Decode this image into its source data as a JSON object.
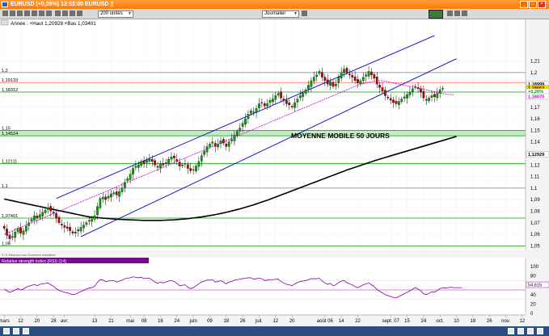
{
  "window": {
    "title": "EURUSD (+0,26%) 13:53:00 EURUSD || "
  },
  "toolbar": {
    "units": "200 unités",
    "period": "Journalier"
  },
  "header": {
    "info": "Année : +Haut 1,20928 +Bas 1,03401",
    "copyright": "© IT-Finance.com Données retardées"
  },
  "rsi": {
    "label": "Relative strength index (RSI) (14)",
    "value": "54,615"
  },
  "colors": {
    "ma50": "#c000c0",
    "ma200": "#000000",
    "channel": "#0000cc",
    "bull": "#00aa00",
    "bear": "#cc0000",
    "hline": "#7bc67b"
  },
  "chart_data": {
    "type": "candlestick",
    "instrument": "EURUSD",
    "period": "daily",
    "ylim": [
      1.045,
      1.225
    ],
    "yticks": [
      1.05,
      1.06,
      1.07,
      1.08,
      1.09,
      1.1,
      1.11,
      1.12,
      1.13,
      1.14,
      1.15,
      1.16,
      1.17,
      1.18,
      1.19,
      1.2,
      1.21
    ],
    "ytick_labels": [
      "1,05",
      "1,06",
      "1,07",
      "1,08",
      "1,09",
      "1,1",
      "1,11",
      "1,12",
      "1,13",
      "1,14",
      "1,15",
      "1,16",
      "1,17",
      "1,18",
      "1,19",
      "1,2",
      "1,21"
    ],
    "xticks": [
      {
        "label": "mars",
        "i": 0
      },
      {
        "label": "12",
        "i": 6
      },
      {
        "label": "20",
        "i": 12
      },
      {
        "label": "28",
        "i": 18
      },
      {
        "label": "avr.",
        "i": 22
      },
      {
        "label": "13",
        "i": 33
      },
      {
        "label": "21",
        "i": 39
      },
      {
        "label": "mai",
        "i": 46
      },
      {
        "label": "08",
        "i": 51
      },
      {
        "label": "16",
        "i": 57
      },
      {
        "label": "24",
        "i": 63
      },
      {
        "label": "juin",
        "i": 69
      },
      {
        "label": "09",
        "i": 75
      },
      {
        "label": "18",
        "i": 81
      },
      {
        "label": "26",
        "i": 87
      },
      {
        "label": "juil.",
        "i": 93
      },
      {
        "label": "12",
        "i": 99
      },
      {
        "label": "20",
        "i": 105
      },
      {
        "label": "août 06",
        "i": 117
      },
      {
        "label": "14",
        "i": 123
      },
      {
        "label": "22",
        "i": 129
      },
      {
        "label": "sept. 07",
        "i": 141
      },
      {
        "label": "15",
        "i": 147
      },
      {
        "label": "24",
        "i": 153
      },
      {
        "label": "oct.",
        "i": 159
      },
      {
        "label": "10",
        "i": 165
      },
      {
        "label": "18",
        "i": 171
      },
      {
        "label": "26",
        "i": 177
      },
      {
        "label": "nov.",
        "i": 183
      },
      {
        "label": "12",
        "i": 189
      }
    ],
    "candles_count": 168,
    "close": [
      1.065,
      1.059,
      1.056,
      1.058,
      1.062,
      1.065,
      1.061,
      1.063,
      1.067,
      1.07,
      1.073,
      1.076,
      1.074,
      1.077,
      1.079,
      1.081,
      1.083,
      1.08,
      1.078,
      1.074,
      1.07,
      1.068,
      1.066,
      1.065,
      1.063,
      1.061,
      1.062,
      1.064,
      1.066,
      1.068,
      1.07,
      1.072,
      1.073,
      1.076,
      1.084,
      1.091,
      1.092,
      1.09,
      1.093,
      1.095,
      1.096,
      1.094,
      1.097,
      1.1,
      1.105,
      1.108,
      1.112,
      1.117,
      1.119,
      1.12,
      1.123,
      1.121,
      1.124,
      1.125,
      1.123,
      1.12,
      1.118,
      1.121,
      1.12,
      1.122,
      1.125,
      1.127,
      1.126,
      1.123,
      1.119,
      1.12,
      1.121,
      1.117,
      1.115,
      1.116,
      1.119,
      1.123,
      1.128,
      1.132,
      1.136,
      1.138,
      1.14,
      1.136,
      1.138,
      1.141,
      1.139,
      1.136,
      1.14,
      1.142,
      1.146,
      1.149,
      1.152,
      1.156,
      1.16,
      1.164,
      1.167,
      1.166,
      1.169,
      1.173,
      1.174,
      1.171,
      1.173,
      1.176,
      1.177,
      1.18,
      1.182,
      1.178,
      1.176,
      1.173,
      1.172,
      1.17,
      1.174,
      1.177,
      1.18,
      1.182,
      1.185,
      1.189,
      1.193,
      1.196,
      1.198,
      1.201,
      1.196,
      1.193,
      1.19,
      1.192,
      1.188,
      1.19,
      1.196,
      1.2,
      1.203,
      1.2,
      1.198,
      1.196,
      1.193,
      1.191,
      1.193,
      1.196,
      1.198,
      1.201,
      1.198,
      1.195,
      1.19,
      1.187,
      1.184,
      1.18,
      1.178,
      1.176,
      1.174,
      1.173,
      1.175,
      1.177,
      1.179,
      1.181,
      1.183,
      1.186,
      1.188,
      1.186,
      1.183,
      1.178,
      1.176,
      1.178,
      1.18,
      1.179,
      1.182,
      1.185,
      1.1865
    ],
    "candle_range_note": "high/low approximately ±0.004 around open/close",
    "ma50": [
      1.06,
      1.061,
      1.062,
      1.063,
      1.064,
      1.065,
      1.066,
      1.067,
      1.068,
      1.069,
      1.07,
      1.071,
      1.072,
      1.073,
      1.074,
      1.075,
      1.076,
      1.077,
      1.078,
      1.079,
      1.08,
      1.081,
      1.082,
      1.083,
      1.084,
      1.085,
      1.086,
      1.087,
      1.088,
      1.089,
      1.09,
      1.091,
      1.092,
      1.093,
      1.094,
      1.095,
      1.096,
      1.097,
      1.098,
      1.099,
      1.1,
      1.101,
      1.102,
      1.103,
      1.104,
      1.105,
      1.106,
      1.107,
      1.108,
      1.109,
      1.11,
      1.111,
      1.112,
      1.113,
      1.114,
      1.115,
      1.116,
      1.117,
      1.118,
      1.119,
      1.12,
      1.121,
      1.122,
      1.123,
      1.124,
      1.125,
      1.126,
      1.127,
      1.128,
      1.129,
      1.13,
      1.131,
      1.132,
      1.133,
      1.134,
      1.135,
      1.136,
      1.137,
      1.138,
      1.139,
      1.14,
      1.141,
      1.142,
      1.143,
      1.144,
      1.145,
      1.146,
      1.147,
      1.148,
      1.149,
      1.15,
      1.151,
      1.152,
      1.153,
      1.154,
      1.155,
      1.156,
      1.157,
      1.158,
      1.159,
      1.16,
      1.161,
      1.162,
      1.163,
      1.164,
      1.165,
      1.166,
      1.167,
      1.168,
      1.169,
      1.17,
      1.171,
      1.172,
      1.173,
      1.174,
      1.175,
      1.176,
      1.177,
      1.178,
      1.179,
      1.18,
      1.181,
      1.182,
      1.183,
      1.184,
      1.185,
      1.186,
      1.187,
      1.188,
      1.189,
      1.19,
      1.1905,
      1.191,
      1.1915,
      1.192,
      1.1925,
      1.193,
      1.193,
      1.193,
      1.1925,
      1.192,
      1.1915,
      1.191,
      1.1905,
      1.19,
      1.1895,
      1.189,
      1.1885,
      1.188,
      1.1875,
      1.187,
      1.1865,
      1.186,
      1.1855,
      1.185,
      1.1845,
      1.184,
      1.1835,
      1.183,
      1.1825,
      1.182,
      1.1815,
      1.181,
      1.181,
      1.181
    ],
    "ma200": [
      1.0905,
      1.09,
      1.0895,
      1.089,
      1.0885,
      1.088,
      1.0875,
      1.087,
      1.0865,
      1.086,
      1.0855,
      1.085,
      1.0845,
      1.084,
      1.0835,
      1.083,
      1.0825,
      1.082,
      1.0815,
      1.081,
      1.0805,
      1.08,
      1.0795,
      1.079,
      1.0785,
      1.078,
      1.0775,
      1.077,
      1.0765,
      1.076,
      1.0755,
      1.075,
      1.0748,
      1.0746,
      1.0744,
      1.0742,
      1.074,
      1.0738,
      1.0736,
      1.0734,
      1.0732,
      1.073,
      1.0729,
      1.0728,
      1.0727,
      1.0726,
      1.0725,
      1.0724,
      1.0723,
      1.0722,
      1.0721,
      1.072,
      1.072,
      1.072,
      1.072,
      1.072,
      1.072,
      1.072,
      1.0721,
      1.0722,
      1.0723,
      1.0724,
      1.0725,
      1.0727,
      1.0729,
      1.0731,
      1.0733,
      1.0735,
      1.0738,
      1.0741,
      1.0744,
      1.0747,
      1.075,
      1.0754,
      1.0758,
      1.0762,
      1.0766,
      1.077,
      1.0775,
      1.078,
      1.0785,
      1.079,
      1.0796,
      1.0802,
      1.0808,
      1.0814,
      1.082,
      1.0827,
      1.0834,
      1.0841,
      1.0848,
      1.0855,
      1.0863,
      1.0871,
      1.0879,
      1.0887,
      1.0895,
      1.0904,
      1.0913,
      1.0922,
      1.0931,
      1.094,
      1.0949,
      1.0958,
      1.0967,
      1.0976,
      1.0985,
      1.0994,
      1.1003,
      1.1012,
      1.1021,
      1.103,
      1.1039,
      1.1048,
      1.1057,
      1.1066,
      1.1075,
      1.1084,
      1.1093,
      1.1102,
      1.1111,
      1.112,
      1.1129,
      1.1138,
      1.1147,
      1.1156,
      1.1164,
      1.1172,
      1.118,
      1.1188,
      1.1196,
      1.1204,
      1.1212,
      1.122,
      1.1228,
      1.1236,
      1.1244,
      1.1251,
      1.1258,
      1.1265,
      1.1272,
      1.1279,
      1.1286,
      1.1293,
      1.13,
      1.1307,
      1.1314,
      1.1321,
      1.1328,
      1.1335,
      1.1342,
      1.1349,
      1.1356,
      1.1363,
      1.137,
      1.1377,
      1.1384,
      1.1391,
      1.1398,
      1.1405,
      1.1412,
      1.1419,
      1.1426,
      1.1433,
      1.144,
      1.1447
    ],
    "annotation": "MOYENNE MOBILE 50 JOURS",
    "hlines": [
      {
        "value": 1.2,
        "label": "1,2",
        "color": "#808080"
      },
      {
        "value": 1.19133,
        "label": "1,19133",
        "color": "#ff6060"
      },
      {
        "value": 1.18312,
        "label": "1,18312",
        "color": "#00a000"
      },
      {
        "value": 1.15,
        "label": "1,15",
        "color": "#00a000"
      },
      {
        "value": 1.14524,
        "label": "1,14524",
        "color": "#00a000"
      },
      {
        "value": 1.12111,
        "label": "1,12111",
        "color": "#00a000"
      },
      {
        "value": 1.1,
        "label": "1,1",
        "color": "#808080"
      },
      {
        "value": 1.07401,
        "label": "1,07401",
        "color": "#00a000"
      },
      {
        "value": 1.05,
        "label": "1,05",
        "color": "#00a000"
      }
    ],
    "zone": {
      "from": 1.14524,
      "to": 1.15
    },
    "price_tags": [
      {
        "value": 1.18999,
        "label": "1,18999",
        "bg": "#ffffff",
        "fg": "#000000"
      },
      {
        "value": 1.18653,
        "label": "1,18652",
        "bg": "#ffd700",
        "fg": "#000000"
      },
      {
        "value": 1.18375,
        "label": "+0,26%",
        "bg": "#ffffff",
        "fg": "#00a000"
      },
      {
        "value": 1.1793,
        "label": "1,18075",
        "bg": "#ffffff",
        "fg": "#c000c0"
      },
      {
        "value": 1.12929,
        "label": "1,12929",
        "bg": "#ffffff",
        "fg": "#000000"
      }
    ],
    "channel": [
      {
        "i1": 19,
        "v1": 1.091,
        "i2": 157,
        "v2": 1.232
      },
      {
        "i1": 28,
        "v1": 1.058,
        "i2": 165,
        "v2": 1.212
      }
    ],
    "rsi_ylim": [
      0,
      100
    ],
    "rsi_yticks": [
      0,
      20,
      40,
      60,
      80,
      100
    ],
    "rsi_series": [
      52,
      48,
      45,
      47,
      50,
      53,
      50,
      52,
      56,
      58,
      60,
      62,
      59,
      62,
      63,
      64,
      65,
      61,
      58,
      53,
      49,
      47,
      45,
      44,
      42,
      40,
      41,
      44,
      47,
      49,
      52,
      54,
      55,
      58,
      66,
      72,
      71,
      68,
      69,
      70,
      70,
      67,
      69,
      71,
      74,
      75,
      76,
      78,
      77,
      76,
      77,
      74,
      75,
      75,
      71,
      67,
      64,
      67,
      65,
      67,
      69,
      70,
      68,
      64,
      59,
      60,
      61,
      56,
      53,
      55,
      59,
      63,
      67,
      69,
      71,
      71,
      72,
      67,
      68,
      70,
      67,
      63,
      67,
      68,
      71,
      72,
      73,
      74,
      75,
      76,
      76,
      73,
      74,
      75,
      74,
      70,
      71,
      72,
      72,
      73,
      73,
      68,
      65,
      62,
      61,
      59,
      63,
      66,
      68,
      69,
      70,
      72,
      74,
      74,
      74,
      75,
      69,
      65,
      62,
      64,
      59,
      61,
      66,
      69,
      70,
      66,
      63,
      61,
      57,
      55,
      58,
      61,
      63,
      65,
      61,
      57,
      51,
      47,
      44,
      40,
      38,
      36,
      34,
      33,
      36,
      39,
      42,
      45,
      48,
      52,
      55,
      52,
      48,
      42,
      40,
      43,
      46,
      45,
      49,
      53,
      55,
      54,
      55,
      56,
      55,
      55,
      55,
      55
    ],
    "rsi_levels": [
      30,
      50,
      70
    ]
  }
}
